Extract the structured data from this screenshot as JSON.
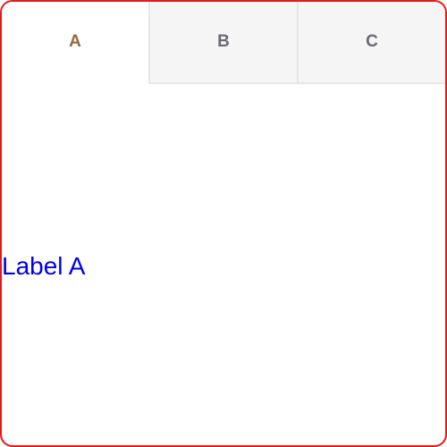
{
  "tabs": [
    {
      "label": "A",
      "active": true
    },
    {
      "label": "B",
      "active": false
    },
    {
      "label": "C",
      "active": false
    }
  ],
  "panel": {
    "label": "Label A"
  },
  "colors": {
    "frame_border": "#e41a1a",
    "active_tab_text": "#94683a",
    "inactive_tab_text": "#6a6a72",
    "inactive_tab_bg": "#f5f5f5",
    "label_text": "#0000ee"
  }
}
